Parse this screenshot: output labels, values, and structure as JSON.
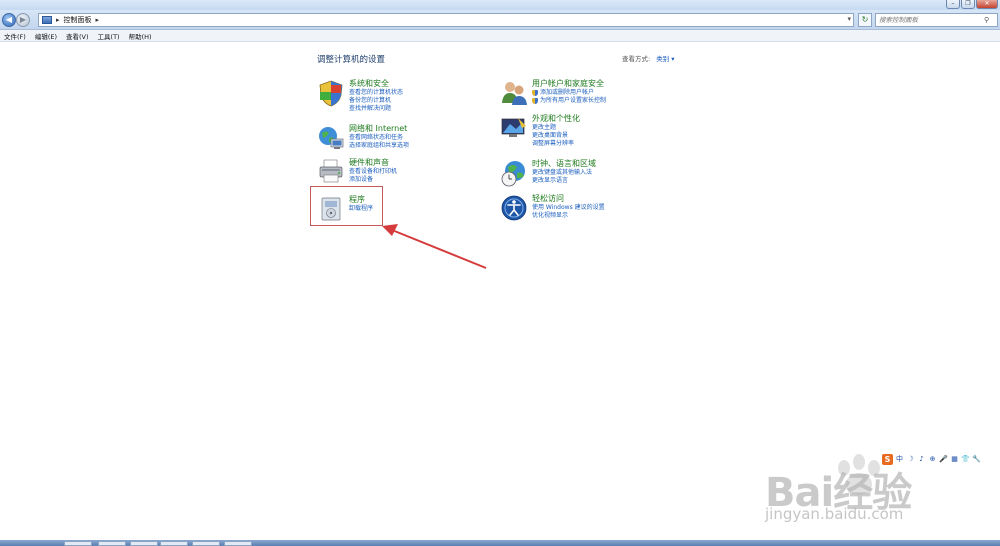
{
  "window": {
    "minimize_glyph": "–",
    "maximize_glyph": "❐",
    "close_glyph": "✕"
  },
  "address": {
    "crumbs": [
      "控制面板"
    ],
    "separator": "▸",
    "search_placeholder": "搜索控制面板"
  },
  "menu": [
    "文件(F)",
    "编辑(E)",
    "查看(V)",
    "工具(T)",
    "帮助(H)"
  ],
  "main": {
    "title": "调整计算机的设置",
    "view_by_label": "查看方式:",
    "view_by_value": "类别 ▾"
  },
  "categories": [
    {
      "title": "系统和安全",
      "links": [
        "查看您的计算机状态",
        "备份您的计算机",
        "查找并解决问题"
      ],
      "icon": "shield-icon"
    },
    {
      "title": "网络和 Internet",
      "links": [
        "查看网络状态和任务",
        "选择家庭组和共享选项"
      ],
      "icon": "network-icon"
    },
    {
      "title": "硬件和声音",
      "links": [
        "查看设备和打印机",
        "添加设备"
      ],
      "icon": "printer-icon"
    },
    {
      "title": "程序",
      "links": [
        "卸载程序"
      ],
      "icon": "programs-icon"
    },
    {
      "title": "用户帐户和家庭安全",
      "links": [
        "添加或删除用户帐户",
        "为所有用户设置家长控制"
      ],
      "icon": "users-icon"
    },
    {
      "title": "外观和个性化",
      "links": [
        "更改主题",
        "更改桌面背景",
        "调整屏幕分辨率"
      ],
      "icon": "appearance-icon"
    },
    {
      "title": "时钟、语言和区域",
      "links": [
        "更改键盘或其他输入法",
        "更改显示语言"
      ],
      "icon": "clock-globe-icon"
    },
    {
      "title": "轻松访问",
      "links": [
        "使用 Windows 建议的设置",
        "优化视频显示"
      ],
      "icon": "ease-of-access-icon"
    }
  ],
  "watermark": {
    "brand": "Bai经验",
    "url": "jingyan.baidu.com"
  },
  "ime": {
    "logo": "S",
    "icons": [
      "中",
      "☽",
      "♪",
      "⊕",
      "🎤",
      "▦",
      "👕",
      "🔧"
    ]
  }
}
